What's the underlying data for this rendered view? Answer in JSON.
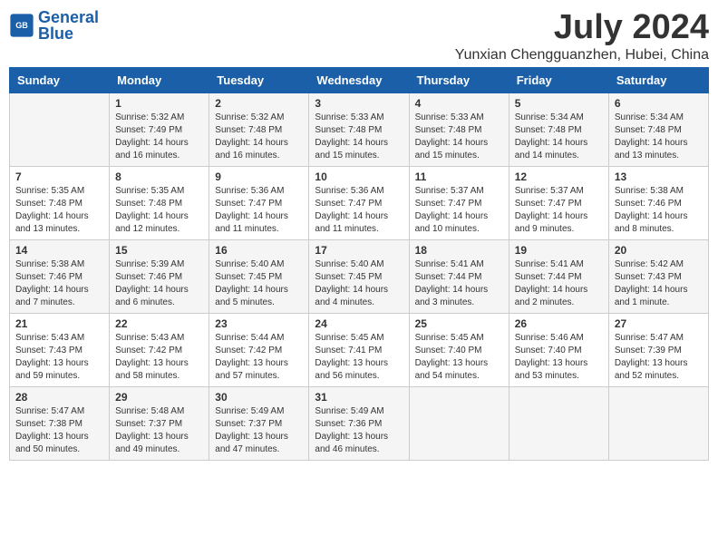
{
  "header": {
    "logo_line1": "General",
    "logo_line2": "Blue",
    "month": "July 2024",
    "location": "Yunxian Chengguanzhen, Hubei, China"
  },
  "weekdays": [
    "Sunday",
    "Monday",
    "Tuesday",
    "Wednesday",
    "Thursday",
    "Friday",
    "Saturday"
  ],
  "weeks": [
    [
      {
        "day": "",
        "info": ""
      },
      {
        "day": "1",
        "info": "Sunrise: 5:32 AM\nSunset: 7:49 PM\nDaylight: 14 hours\nand 16 minutes."
      },
      {
        "day": "2",
        "info": "Sunrise: 5:32 AM\nSunset: 7:48 PM\nDaylight: 14 hours\nand 16 minutes."
      },
      {
        "day": "3",
        "info": "Sunrise: 5:33 AM\nSunset: 7:48 PM\nDaylight: 14 hours\nand 15 minutes."
      },
      {
        "day": "4",
        "info": "Sunrise: 5:33 AM\nSunset: 7:48 PM\nDaylight: 14 hours\nand 15 minutes."
      },
      {
        "day": "5",
        "info": "Sunrise: 5:34 AM\nSunset: 7:48 PM\nDaylight: 14 hours\nand 14 minutes."
      },
      {
        "day": "6",
        "info": "Sunrise: 5:34 AM\nSunset: 7:48 PM\nDaylight: 14 hours\nand 13 minutes."
      }
    ],
    [
      {
        "day": "7",
        "info": "Sunrise: 5:35 AM\nSunset: 7:48 PM\nDaylight: 14 hours\nand 13 minutes."
      },
      {
        "day": "8",
        "info": "Sunrise: 5:35 AM\nSunset: 7:48 PM\nDaylight: 14 hours\nand 12 minutes."
      },
      {
        "day": "9",
        "info": "Sunrise: 5:36 AM\nSunset: 7:47 PM\nDaylight: 14 hours\nand 11 minutes."
      },
      {
        "day": "10",
        "info": "Sunrise: 5:36 AM\nSunset: 7:47 PM\nDaylight: 14 hours\nand 11 minutes."
      },
      {
        "day": "11",
        "info": "Sunrise: 5:37 AM\nSunset: 7:47 PM\nDaylight: 14 hours\nand 10 minutes."
      },
      {
        "day": "12",
        "info": "Sunrise: 5:37 AM\nSunset: 7:47 PM\nDaylight: 14 hours\nand 9 minutes."
      },
      {
        "day": "13",
        "info": "Sunrise: 5:38 AM\nSunset: 7:46 PM\nDaylight: 14 hours\nand 8 minutes."
      }
    ],
    [
      {
        "day": "14",
        "info": "Sunrise: 5:38 AM\nSunset: 7:46 PM\nDaylight: 14 hours\nand 7 minutes."
      },
      {
        "day": "15",
        "info": "Sunrise: 5:39 AM\nSunset: 7:46 PM\nDaylight: 14 hours\nand 6 minutes."
      },
      {
        "day": "16",
        "info": "Sunrise: 5:40 AM\nSunset: 7:45 PM\nDaylight: 14 hours\nand 5 minutes."
      },
      {
        "day": "17",
        "info": "Sunrise: 5:40 AM\nSunset: 7:45 PM\nDaylight: 14 hours\nand 4 minutes."
      },
      {
        "day": "18",
        "info": "Sunrise: 5:41 AM\nSunset: 7:44 PM\nDaylight: 14 hours\nand 3 minutes."
      },
      {
        "day": "19",
        "info": "Sunrise: 5:41 AM\nSunset: 7:44 PM\nDaylight: 14 hours\nand 2 minutes."
      },
      {
        "day": "20",
        "info": "Sunrise: 5:42 AM\nSunset: 7:43 PM\nDaylight: 14 hours\nand 1 minute."
      }
    ],
    [
      {
        "day": "21",
        "info": "Sunrise: 5:43 AM\nSunset: 7:43 PM\nDaylight: 13 hours\nand 59 minutes."
      },
      {
        "day": "22",
        "info": "Sunrise: 5:43 AM\nSunset: 7:42 PM\nDaylight: 13 hours\nand 58 minutes."
      },
      {
        "day": "23",
        "info": "Sunrise: 5:44 AM\nSunset: 7:42 PM\nDaylight: 13 hours\nand 57 minutes."
      },
      {
        "day": "24",
        "info": "Sunrise: 5:45 AM\nSunset: 7:41 PM\nDaylight: 13 hours\nand 56 minutes."
      },
      {
        "day": "25",
        "info": "Sunrise: 5:45 AM\nSunset: 7:40 PM\nDaylight: 13 hours\nand 54 minutes."
      },
      {
        "day": "26",
        "info": "Sunrise: 5:46 AM\nSunset: 7:40 PM\nDaylight: 13 hours\nand 53 minutes."
      },
      {
        "day": "27",
        "info": "Sunrise: 5:47 AM\nSunset: 7:39 PM\nDaylight: 13 hours\nand 52 minutes."
      }
    ],
    [
      {
        "day": "28",
        "info": "Sunrise: 5:47 AM\nSunset: 7:38 PM\nDaylight: 13 hours\nand 50 minutes."
      },
      {
        "day": "29",
        "info": "Sunrise: 5:48 AM\nSunset: 7:37 PM\nDaylight: 13 hours\nand 49 minutes."
      },
      {
        "day": "30",
        "info": "Sunrise: 5:49 AM\nSunset: 7:37 PM\nDaylight: 13 hours\nand 47 minutes."
      },
      {
        "day": "31",
        "info": "Sunrise: 5:49 AM\nSunset: 7:36 PM\nDaylight: 13 hours\nand 46 minutes."
      },
      {
        "day": "",
        "info": ""
      },
      {
        "day": "",
        "info": ""
      },
      {
        "day": "",
        "info": ""
      }
    ]
  ]
}
